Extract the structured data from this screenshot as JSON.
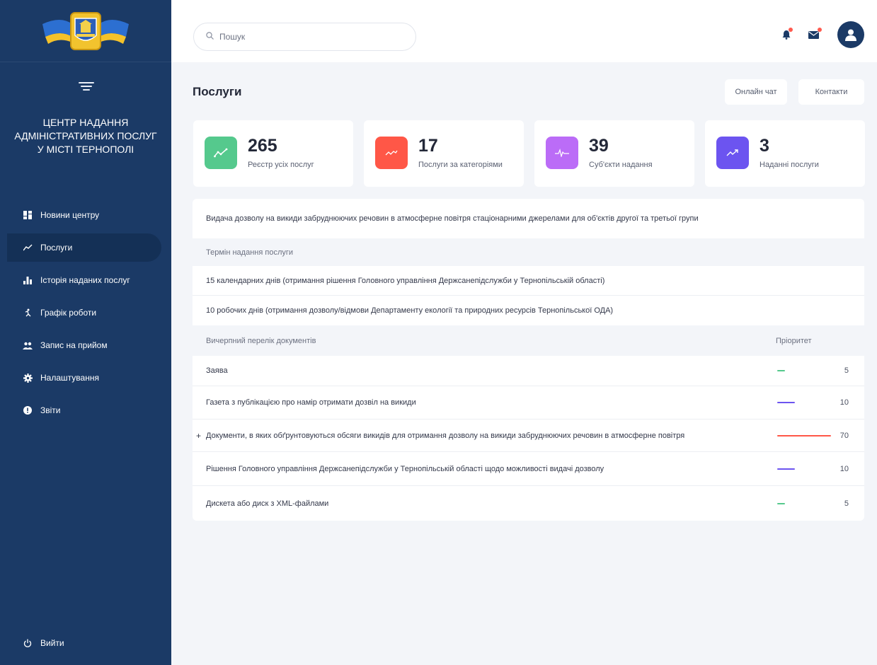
{
  "search": {
    "placeholder": "Пошук"
  },
  "sidebar": {
    "org_title_lines": [
      "ЦЕНТР НАДАННЯ",
      "АДМІНІСТРАТИВНИХ ПОСЛУГ",
      "У МІСТІ ТЕРНОПОЛІ"
    ],
    "items": [
      {
        "label": "Новини центру",
        "icon": "dashboard-icon"
      },
      {
        "label": "Послуги",
        "icon": "trend-icon",
        "active": true
      },
      {
        "label": "Історія наданих послуг",
        "icon": "bar-chart-icon"
      },
      {
        "label": "Графік роботи",
        "icon": "person-running-icon"
      },
      {
        "label": "Запис на прийом",
        "icon": "people-icon"
      },
      {
        "label": "Налаштування",
        "icon": "gear-icon"
      },
      {
        "label": "Звіти",
        "icon": "alert-circle-icon"
      }
    ],
    "logout_label": "Вийти"
  },
  "header": {
    "title": "Послуги",
    "online_chat_label": "Онлайн чат",
    "contacts_label": "Контакти"
  },
  "stats": [
    {
      "value": "265",
      "label": "Реєстр усіх послуг",
      "color": "#55c98d"
    },
    {
      "value": "17",
      "label": "Послуги за категоріями",
      "color": "#ff5747"
    },
    {
      "value": "39",
      "label": "Суб'єкти надання",
      "color": "#bb6cf7"
    },
    {
      "value": "3",
      "label": "Наданні послуги",
      "color": "#6c54f0"
    }
  ],
  "service": {
    "title": "Видача дозволу на викиди забруднюючих речовин в атмосферне повітря стаціонарними джерелами для об'єктів другої та третьої групи",
    "term_header": "Термін надання послуги",
    "terms": [
      "15 календарних днів (отримання рішення Головного управління Держсанепідслужби у Тернопільській області)",
      "10 робочих днів (отримання дозволу/відмови Департаменту екології та природних ресурсів Тернопільської ОДА)"
    ],
    "docs_header": "Вичерпний перелік документів",
    "priority_header": "Пріоритет",
    "documents": [
      {
        "name": "Заява",
        "priority": 5,
        "color": "#55c98d"
      },
      {
        "name": "Газета з публікацією про намір отримати дозвіл на викиди",
        "priority": 10,
        "color": "#6c54f0"
      },
      {
        "name": "Документи, в яких обґрунтовуються обсяги викидів для отримання дозволу на викиди забруднюючих речовин в атмосферне повітря",
        "priority": 70,
        "color": "#ff5747",
        "expandable": true,
        "expand_symbol": "+"
      },
      {
        "name": "Рішення Головного управління Держсанепідслужби у Тернопільській області щодо можливості видачі дозволу",
        "priority": 10,
        "color": "#6c54f0"
      },
      {
        "name": "Дискета або диск з XML-файлами",
        "priority": 5,
        "color": "#55c98d"
      }
    ]
  }
}
